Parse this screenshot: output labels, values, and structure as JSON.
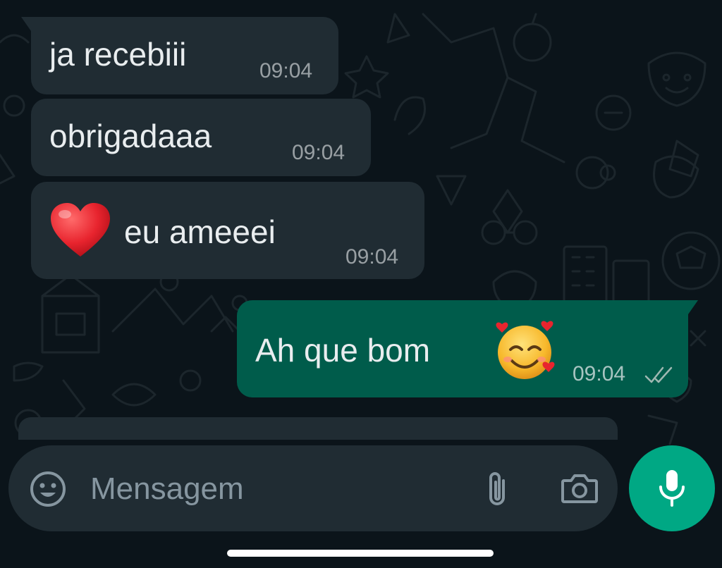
{
  "messages": [
    {
      "direction": "incoming",
      "text": "ja recebiii",
      "time": "09:04"
    },
    {
      "direction": "incoming",
      "text": "obrigadaaa",
      "time": "09:04"
    },
    {
      "direction": "incoming",
      "emoji": "red-heart",
      "text": "eu ameeei",
      "time": "09:04"
    },
    {
      "direction": "outgoing",
      "text": "Ah que bom",
      "emoji": "smiling-face-with-hearts",
      "time": "09:04",
      "status": "read"
    }
  ],
  "composer": {
    "placeholder": "Mensagem",
    "emoji_icon": "emoji-icon",
    "attach_icon": "paperclip-icon",
    "camera_icon": "camera-icon",
    "send_icon": "microphone-icon"
  },
  "colors": {
    "background": "#0b141a",
    "incoming_bubble": "#202c33",
    "outgoing_bubble": "#005c4b",
    "accent": "#00a884",
    "read_ticks": "#8696a0"
  }
}
